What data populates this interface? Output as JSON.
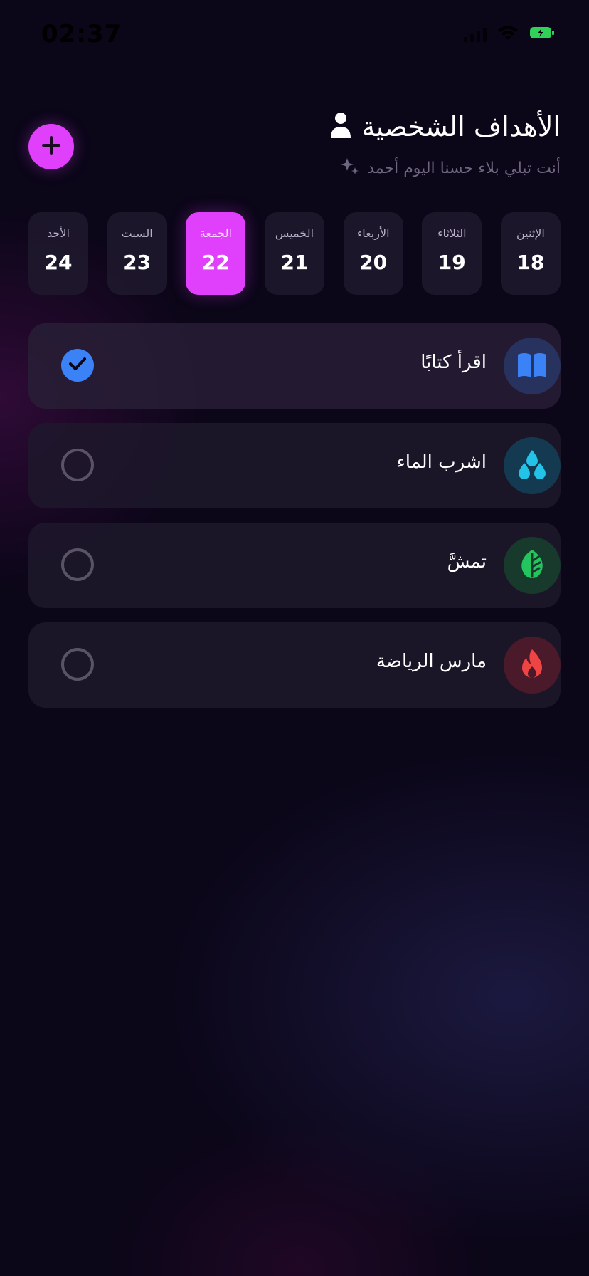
{
  "status_bar": {
    "time": "02:37"
  },
  "header": {
    "title": "الأهداف الشخصية",
    "subtitle": "أنت تبلي بلاء حسنا اليوم أحمد",
    "title_icon": "person-icon",
    "subtitle_icon": "sparkles-icon",
    "add_icon": "plus-icon"
  },
  "days": [
    {
      "name": "الإثنين",
      "number": "18",
      "active": false
    },
    {
      "name": "الثلاثاء",
      "number": "19",
      "active": false
    },
    {
      "name": "الأربعاء",
      "number": "20",
      "active": false
    },
    {
      "name": "الخميس",
      "number": "21",
      "active": false
    },
    {
      "name": "الجمعة",
      "number": "22",
      "active": true
    },
    {
      "name": "السبت",
      "number": "23",
      "active": false
    },
    {
      "name": "الأحد",
      "number": "24",
      "active": false
    }
  ],
  "goals": [
    {
      "label": "اقرأ كتابًا",
      "icon": "book-icon",
      "icon_color": "#3b82f6",
      "icon_bg": "#28325e",
      "completed": true
    },
    {
      "label": "اشرب الماء",
      "icon": "water-drops-icon",
      "icon_color": "#22c3e6",
      "icon_bg": "#143a52",
      "completed": false
    },
    {
      "label": "تمشَّ",
      "icon": "leaf-icon",
      "icon_color": "#22c55e",
      "icon_bg": "#173a2c",
      "completed": false
    },
    {
      "label": "مارس الرياضة",
      "icon": "flame-icon",
      "icon_color": "#ef4444",
      "icon_bg": "#4a1a2a",
      "completed": false
    }
  ],
  "colors": {
    "accent": "#e040fb",
    "check_blue": "#3b82f6",
    "background": "#0b0618"
  }
}
